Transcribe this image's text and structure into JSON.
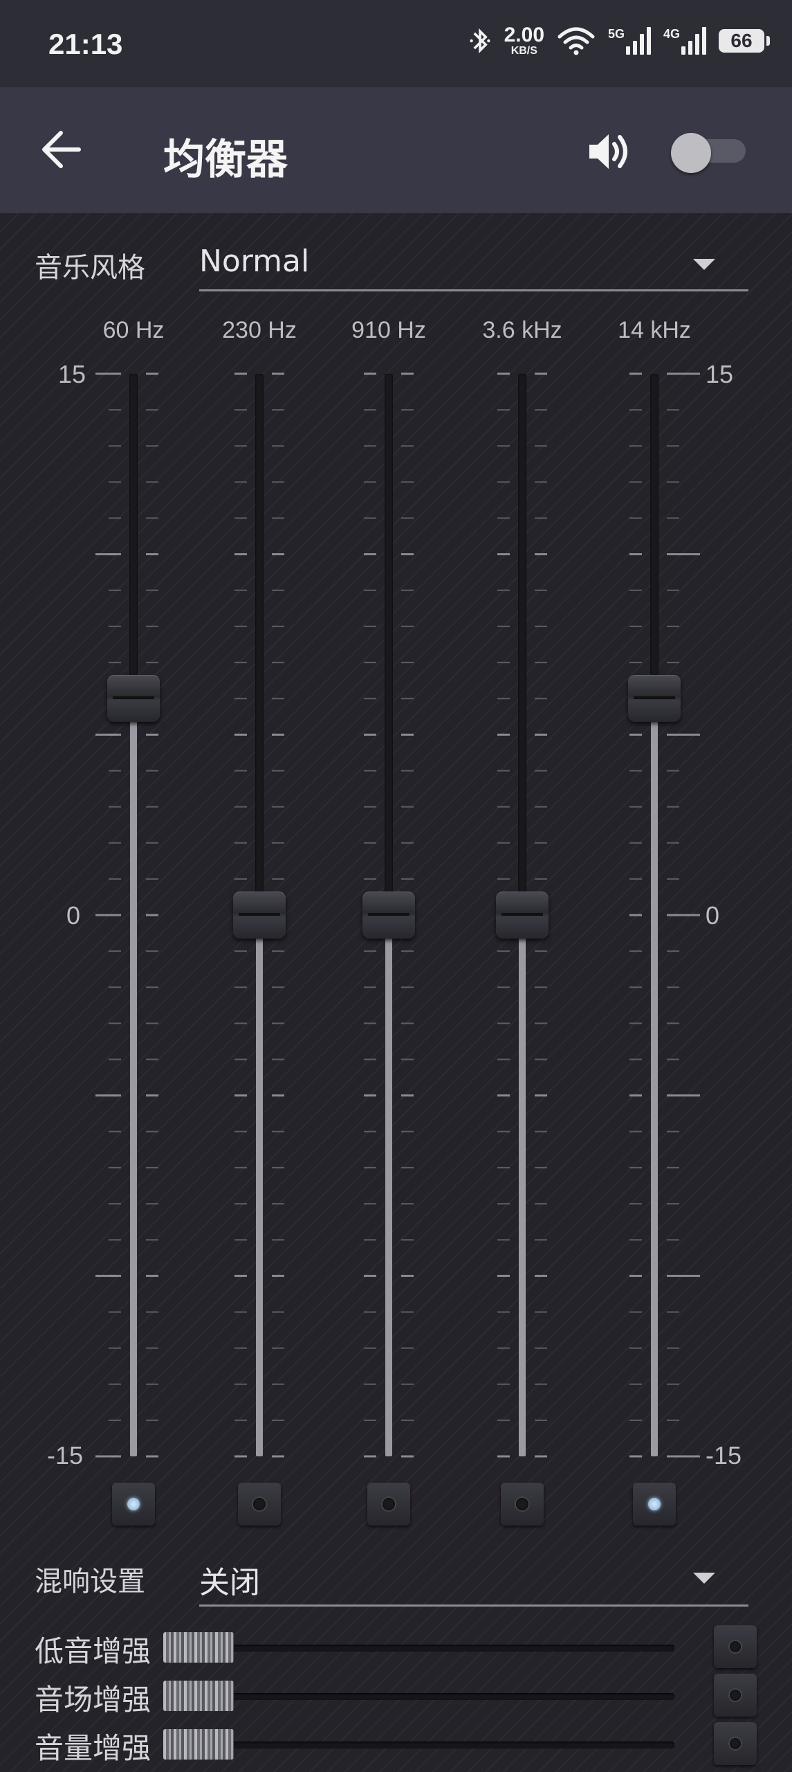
{
  "status_bar": {
    "time": "21:13",
    "net_speed_value": "2.00",
    "net_speed_unit": "KB/S",
    "signal_1_label": "5G",
    "signal_2_label": "4G",
    "battery": "66"
  },
  "app_bar": {
    "title": "均衡器",
    "toggle_on": false
  },
  "preset": {
    "label": "音乐风格",
    "value": "Normal"
  },
  "equalizer": {
    "scale_max": "15",
    "scale_mid": "0",
    "scale_min": "-15",
    "range_db": [
      -15,
      15
    ],
    "bands": [
      {
        "freq": "60 Hz",
        "gain_db": 6,
        "locked": true
      },
      {
        "freq": "230 Hz",
        "gain_db": 0,
        "locked": false
      },
      {
        "freq": "910 Hz",
        "gain_db": 0,
        "locked": false
      },
      {
        "freq": "3.6 kHz",
        "gain_db": 0,
        "locked": false
      },
      {
        "freq": "14 kHz",
        "gain_db": 6,
        "locked": true
      }
    ]
  },
  "reverb": {
    "label": "混响设置",
    "value": "关闭"
  },
  "boosts": [
    {
      "label": "低音增强",
      "level": 0
    },
    {
      "label": "音场增强",
      "level": 0
    },
    {
      "label": "音量增强",
      "level": 0
    }
  ]
}
